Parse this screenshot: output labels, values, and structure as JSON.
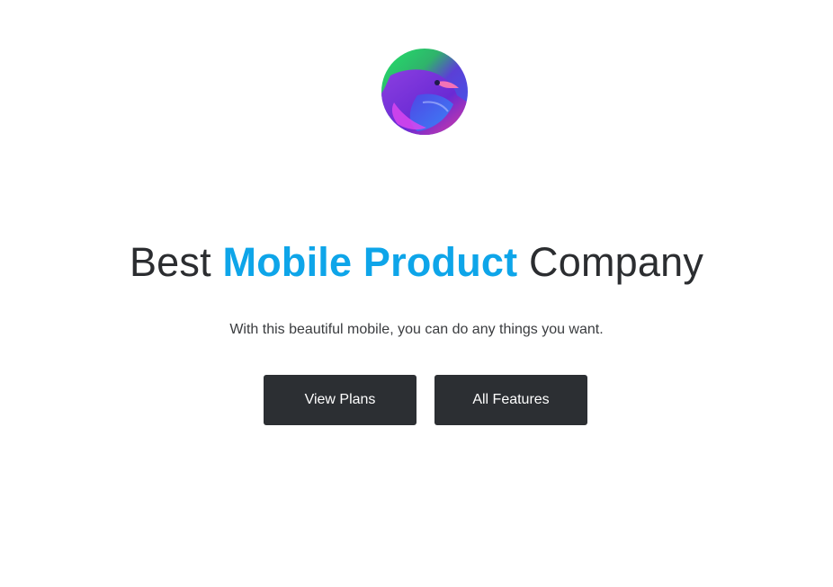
{
  "brand": {
    "logo_icon": "bird-logo-icon",
    "colors": {
      "green": "#22c55e",
      "purple": "#7c3aed",
      "pink": "#ec4899",
      "blue": "#3b82f6"
    }
  },
  "hero": {
    "headline_start": "Best",
    "headline_accent": "Mobile Product",
    "headline_end": "Company",
    "accent_color": "#0ea5e9",
    "tagline": "With this beautiful mobile, you can do any things you want."
  },
  "actions": {
    "view_plans_label": "View Plans",
    "all_features_label": "All Features",
    "button_color": "#2c2f33"
  }
}
